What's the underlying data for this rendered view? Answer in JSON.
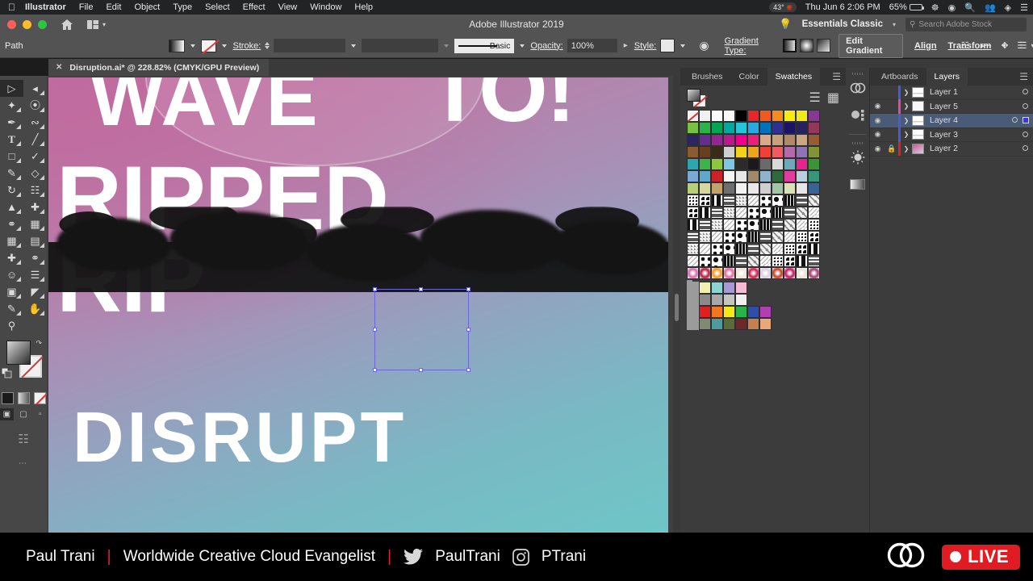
{
  "os_menu": {
    "apple_icon": "apple-icon",
    "items": [
      "Illustrator",
      "File",
      "Edit",
      "Object",
      "Type",
      "Select",
      "Effect",
      "View",
      "Window",
      "Help"
    ],
    "status": {
      "temperature": "43°",
      "day_time": "Thu Jun 6  2:06 PM",
      "battery": "65%",
      "icons": [
        "control-center-icon",
        "siri-icon",
        "spotlight-search-icon",
        "users-icon",
        "dropbox-icon",
        "list-icon"
      ]
    }
  },
  "titlebar": {
    "app_title": "Adobe Illustrator 2019",
    "home_icon": "home-icon",
    "layout_icon": "arrange-documents-icon",
    "workspace": "Essentials Classic",
    "search_placeholder": "Search Adobe Stock",
    "bulb_icon": "lightbulb-icon"
  },
  "control_bar": {
    "selection_label": "Path",
    "fill_swatch": "gradient-fill-swatch",
    "stroke_swatch": "none-stroke-swatch",
    "stroke_label": "Stroke:",
    "stroke_weight": "",
    "brush_definition": "Basic",
    "opacity_label": "Opacity:",
    "opacity_value": "100%",
    "style_label": "Style:",
    "recolor_icon": "recolor-artwork-icon",
    "gradient_type_label": "Gradient Type:",
    "gradient_types": [
      "linear-gradient-button",
      "radial-gradient-button",
      "freeform-gradient-button"
    ],
    "gradient_type_selected": "linear-gradient-button",
    "edit_gradient": "Edit Gradient",
    "align": "Align",
    "transform": "Transform",
    "icons": [
      "isolate-selected-icon",
      "arrange-objects-icon",
      "select-similar-icon",
      "document-setup-icon",
      "preferences-icon",
      "more-options-icon"
    ]
  },
  "document_tab": {
    "close_icon": "close-tab-icon",
    "title": "Disruption.ai* @ 228.82% (CMYK/GPU Preview)"
  },
  "toolbar": {
    "tools": [
      "selection-tool",
      "direct-selection-tool",
      "magic-wand-tool",
      "lasso-tool",
      "pen-tool",
      "curvature-tool",
      "type-tool",
      "line-segment-tool",
      "rectangle-tool",
      "paintbrush-tool",
      "pencil-tool",
      "shaper-eraser-tool",
      "rotate-tool",
      "scale-tool",
      "width-tool",
      "free-transform-tool",
      "shape-builder-tool",
      "perspective-grid-tool",
      "mesh-tool",
      "gradient-tool",
      "eyedropper-tool",
      "blend-tool",
      "symbol-sprayer-tool",
      "column-graph-tool",
      "artboard-tool",
      "slice-tool",
      "hand-tool-alt",
      "hand-tool",
      "zoom-tool"
    ],
    "fill_swatch": "gradient-fill",
    "stroke_swatch": "no-stroke",
    "swap_icon": "swap-fill-stroke-icon",
    "default_icon": "default-fill-stroke-icon",
    "color_modes": [
      "color-swatch-button",
      "gradient-swatch-button",
      "none-swatch-button"
    ],
    "screen_modes": [
      "normal-screen-mode",
      "full-screen-menubar-mode",
      "full-screen-mode"
    ],
    "edit_toolbar_icon": "edit-toolbar-icon"
  },
  "artwork": {
    "headline_1": "WAVE",
    "headline_2": "TO!",
    "headline_3": "RIPPED",
    "headline_4": "RIP",
    "headline_5": "DISRUPT",
    "gradient_start": "#c4709f",
    "gradient_end": "#6ec6c6",
    "selection_color": "#6a68d8"
  },
  "swatches_panel": {
    "tabs": [
      "Brushes",
      "Color",
      "Swatches"
    ],
    "active_tab": "Swatches",
    "menu_icon": "panel-menu-icon",
    "view_list_icon": "list-view-icon",
    "view_grid_icon": "grid-view-icon",
    "grid": [
      [
        "none",
        "#f0f0f0",
        "#ffffff",
        "#fcfcfc",
        "#000000",
        "#e8252b",
        "#f05a22",
        "#f68b1f",
        "#f6eb16",
        "#f2ea18"
      ],
      [
        "#79c143",
        "#2bb34a",
        "#00a651",
        "#00a99d",
        "#26c6da",
        "#27aae1",
        "#0072bc",
        "#2e3192",
        "#1b1464",
        "#262262"
      ],
      [
        "#2b2560",
        "#652d90",
        "#92278f",
        "#ba1a8b",
        "#ec008c",
        "#ed1e79",
        "#d9a98b",
        "#c7a17a",
        "#b08968",
        "#c9a882"
      ],
      [
        "#8a5a32",
        "#6b3e1e",
        "#3a2a18",
        "#cfcfcf",
        "#f3d21a",
        "#f0a51e",
        "#ef4136",
        "#f15a60",
        "#b36aa8",
        "#8d74b5"
      ],
      [
        "#2aa8b0",
        "#3ab54a",
        "#8dc63f",
        "#7ec8e3",
        "#2b2b2b",
        "#1a1a1a",
        "#6a6a6a",
        "#d9d9d9",
        "#6fa8b8",
        "#e6238f"
      ],
      [
        "#7aa9d4",
        "#5fa8c9",
        "#cc2229",
        "#f5f5f5",
        "#e8e8e8",
        "#a08a6a",
        "#8fb4c9",
        "#2f6b3a",
        "#e13c9e",
        "#b9cfe0"
      ],
      [
        "#b8cf7a",
        "#d6d79a",
        "#c4a26a",
        "#6e6e6e",
        "#f2f2f2",
        "#e9e9e9",
        "#cfcfcf",
        "#9fc7a6",
        "#d8e2b6",
        "#e6e6e6"
      ]
    ],
    "folder_rows": [
      {
        "folder": "swatch-group-folder",
        "colors": [
          "#f2f0b0",
          "#8fd3d3",
          "#a79ad4",
          "#f3bcd4"
        ]
      },
      {
        "folder": "swatch-group-folder",
        "colors": [
          "#8a8a8a",
          "#a8a8a8",
          "#c4c4c4",
          "#f0f0f0"
        ]
      },
      {
        "folder": "swatch-group-folder",
        "colors": [
          "#e02020",
          "#f07820",
          "#f2ea18",
          "#2bb34a",
          "#2e4fa8",
          "#b13fb1"
        ]
      },
      {
        "folder": "swatch-group-folder",
        "colors": [
          "#7e8a72",
          "#4f9a9a",
          "#5a6a3a",
          "#6b2a2a",
          "#c58050",
          "#e8a878"
        ]
      }
    ]
  },
  "icon_dock": {
    "items": [
      "creative-cloud-libraries-icon",
      "symbols-icon",
      "brushes-panel-icon",
      "gradient-panel-icon"
    ]
  },
  "layers_panel": {
    "tabs": [
      "Artboards",
      "Layers"
    ],
    "active_tab": "Layers",
    "menu_icon": "panel-menu-icon",
    "rows": [
      {
        "name": "Layer 1",
        "visible": false,
        "locked": false,
        "color": "#4a5ad8",
        "selected": false,
        "has_target": false
      },
      {
        "name": "Layer 5",
        "visible": true,
        "locked": false,
        "color": "#e04ba0",
        "selected": false,
        "has_target": false
      },
      {
        "name": "Layer 4",
        "visible": true,
        "locked": false,
        "color": "#4a5ad8",
        "selected": true,
        "has_target": true
      },
      {
        "name": "Layer 3",
        "visible": true,
        "locked": false,
        "color": "#4a5ad8",
        "selected": false,
        "has_target": false
      },
      {
        "name": "Layer 2",
        "visible": true,
        "locked": true,
        "color": "#e02020",
        "selected": false,
        "has_target": false
      }
    ]
  },
  "banner": {
    "presenter": "Paul Trani",
    "divider": "|",
    "role": "Worldwide Creative Cloud Evangelist",
    "twitter_icon": "twitter-icon",
    "twitter_handle": "PaulTrani",
    "instagram_icon": "instagram-icon",
    "instagram_handle": "PTrani",
    "cc_icon": "creative-cloud-icon",
    "live_label": "LIVE",
    "live_color": "#e11b22"
  }
}
